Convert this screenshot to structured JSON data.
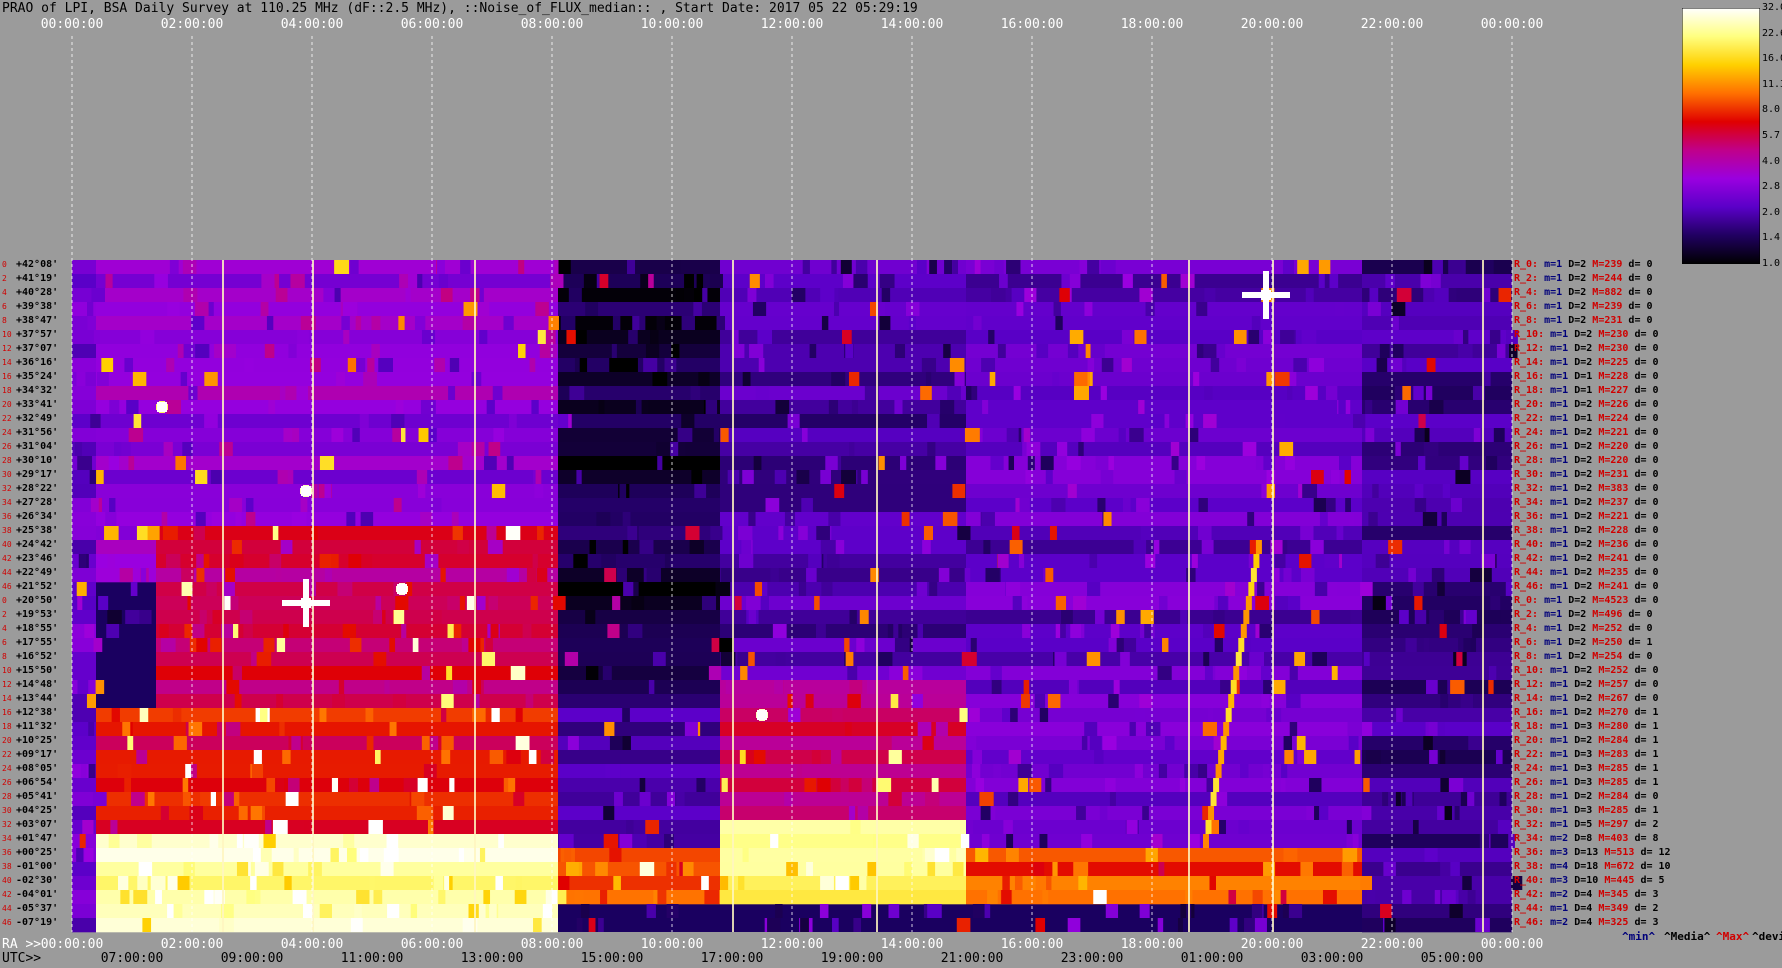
{
  "title": "PRAO of LPI, BSA Daily Survey at 110.25 MHz (dF::2.5 MHz), ::Noise_of_FLUX_median:: , Start Date: 2017 05 22 05:29:19",
  "axis": {
    "top_ticks": [
      "00:00:00",
      "02:00:00",
      "04:00:00",
      "06:00:00",
      "08:00:00",
      "10:00:00",
      "12:00:00",
      "14:00:00",
      "16:00:00",
      "18:00:00",
      "20:00:00",
      "22:00:00",
      "00:00:00"
    ],
    "ra_label": "RA >>",
    "ra_ticks": [
      "00:00:00",
      "02:00:00",
      "04:00:00",
      "06:00:00",
      "08:00:00",
      "10:00:00",
      "12:00:00",
      "14:00:00",
      "16:00:00",
      "18:00:00",
      "20:00:00",
      "22:00:00",
      "00:00:00"
    ],
    "utc_label": "UTC>>",
    "utc_ticks": [
      "07:00:00",
      "09:00:00",
      "11:00:00",
      "13:00:00",
      "15:00:00",
      "17:00:00",
      "19:00:00",
      "21:00:00",
      "23:00:00",
      "01:00:00",
      "03:00:00",
      "05:00:00"
    ]
  },
  "colorbar": {
    "labels": [
      "32.0",
      "22.6",
      "16.0",
      "11.3",
      "8.0",
      "5.7",
      "4.0",
      "2.8",
      "2.0",
      "1.4",
      "1.0"
    ],
    "stops": [
      "#ffffff",
      "#ffff80",
      "#ffd000",
      "#ff7000",
      "#e00000",
      "#c0008a",
      "#9a00e0",
      "#5a00c8",
      "#200060",
      "#000000"
    ]
  },
  "legend": {
    "min": "^min^",
    "median": "^Media^",
    "max": "^Max^",
    "devia": "^devia^"
  },
  "declinations": [
    "+42°08'",
    "+41°19'",
    "+40°28'",
    "+39°38'",
    "+38°47'",
    "+37°57'",
    "+37°07'",
    "+36°16'",
    "+35°24'",
    "+34°32'",
    "+33°41'",
    "+32°49'",
    "+31°56'",
    "+31°04'",
    "+30°10'",
    "+29°17'",
    "+28°22'",
    "+27°28'",
    "+26°34'",
    "+25°38'",
    "+24°42'",
    "+23°46'",
    "+22°49'",
    "+21°52'",
    "+20°50'",
    "+19°53'",
    "+18°55'",
    "+17°55'",
    "+16°52'",
    "+15°50'",
    "+14°48'",
    "+13°44'",
    "+12°38'",
    "+11°32'",
    "+10°25'",
    "+09°17'",
    "+08°05'",
    "+06°54'",
    "+05°41'",
    "+04°25'",
    "+03°07'",
    "+01°47'",
    "+00°25'",
    "-01°00'",
    "-02°30'",
    "-04°01'",
    "-05°37'",
    "-07°19'"
  ],
  "row_index": [
    "0",
    "2",
    "4",
    "6",
    "8",
    "10",
    "12",
    "14",
    "16",
    "18",
    "20",
    "22",
    "24",
    "26",
    "28",
    "30",
    "32",
    "34",
    "36",
    "38",
    "40",
    "42",
    "44",
    "46",
    "0",
    "2",
    "4",
    "6",
    "8",
    "10",
    "12",
    "14",
    "16",
    "18",
    "20",
    "22",
    "24",
    "26",
    "28",
    "30",
    "32",
    "34",
    "36",
    "38",
    "40",
    "42",
    "44",
    "46"
  ],
  "stats": [
    [
      "R_0:",
      "m=1",
      "D=2",
      "M=239",
      "d= 0"
    ],
    [
      "R_2:",
      "m=1",
      "D=2",
      "M=244",
      "d= 0"
    ],
    [
      "R_4:",
      "m=1",
      "D=2",
      "M=882",
      "d= 0"
    ],
    [
      "R_6:",
      "m=1",
      "D=2",
      "M=239",
      "d= 0"
    ],
    [
      "R_8:",
      "m=1",
      "D=2",
      "M=231",
      "d= 0"
    ],
    [
      "R_10:",
      "m=1",
      "D=2",
      "M=230",
      "d= 0"
    ],
    [
      "R_12:",
      "m=1",
      "D=2",
      "M=230",
      "d= 0"
    ],
    [
      "R_14:",
      "m=1",
      "D=2",
      "M=225",
      "d= 0"
    ],
    [
      "R_16:",
      "m=1",
      "D=1",
      "M=228",
      "d= 0"
    ],
    [
      "R_18:",
      "m=1",
      "D=1",
      "M=227",
      "d= 0"
    ],
    [
      "R_20:",
      "m=1",
      "D=2",
      "M=226",
      "d= 0"
    ],
    [
      "R_22:",
      "m=1",
      "D=1",
      "M=224",
      "d= 0"
    ],
    [
      "R_24:",
      "m=1",
      "D=2",
      "M=221",
      "d= 0"
    ],
    [
      "R_26:",
      "m=1",
      "D=2",
      "M=220",
      "d= 0"
    ],
    [
      "R_28:",
      "m=1",
      "D=2",
      "M=220",
      "d= 0"
    ],
    [
      "R_30:",
      "m=1",
      "D=2",
      "M=231",
      "d= 0"
    ],
    [
      "R_32:",
      "m=1",
      "D=2",
      "M=383",
      "d= 0"
    ],
    [
      "R_34:",
      "m=1",
      "D=2",
      "M=237",
      "d= 0"
    ],
    [
      "R_36:",
      "m=1",
      "D=2",
      "M=221",
      "d= 0"
    ],
    [
      "R_38:",
      "m=1",
      "D=2",
      "M=228",
      "d= 0"
    ],
    [
      "R_40:",
      "m=1",
      "D=2",
      "M=236",
      "d= 0"
    ],
    [
      "R_42:",
      "m=1",
      "D=2",
      "M=241",
      "d= 0"
    ],
    [
      "R_44:",
      "m=1",
      "D=2",
      "M=235",
      "d= 0"
    ],
    [
      "R_46:",
      "m=1",
      "D=2",
      "M=241",
      "d= 0"
    ],
    [
      "R_0:",
      "m=1",
      "D=2",
      "M=4523",
      "d= 0"
    ],
    [
      "R_2:",
      "m=1",
      "D=2",
      "M=496",
      "d= 0"
    ],
    [
      "R_4:",
      "m=1",
      "D=2",
      "M=252",
      "d= 0"
    ],
    [
      "R_6:",
      "m=1",
      "D=2",
      "M=250",
      "d= 1"
    ],
    [
      "R_8:",
      "m=1",
      "D=2",
      "M=254",
      "d= 0"
    ],
    [
      "R_10:",
      "m=1",
      "D=2",
      "M=252",
      "d= 0"
    ],
    [
      "R_12:",
      "m=1",
      "D=2",
      "M=257",
      "d= 0"
    ],
    [
      "R_14:",
      "m=1",
      "D=2",
      "M=267",
      "d= 0"
    ],
    [
      "R_16:",
      "m=1",
      "D=2",
      "M=270",
      "d= 1"
    ],
    [
      "R_18:",
      "m=1",
      "D=3",
      "M=280",
      "d= 1"
    ],
    [
      "R_20:",
      "m=1",
      "D=2",
      "M=284",
      "d= 1"
    ],
    [
      "R_22:",
      "m=1",
      "D=3",
      "M=283",
      "d= 1"
    ],
    [
      "R_24:",
      "m=1",
      "D=3",
      "M=285",
      "d= 1"
    ],
    [
      "R_26:",
      "m=1",
      "D=3",
      "M=285",
      "d= 1"
    ],
    [
      "R_28:",
      "m=1",
      "D=2",
      "M=284",
      "d= 0"
    ],
    [
      "R_30:",
      "m=1",
      "D=3",
      "M=285",
      "d= 1"
    ],
    [
      "R_32:",
      "m=1",
      "D=5",
      "M=297",
      "d= 2"
    ],
    [
      "R_34:",
      "m=2",
      "D=8",
      "M=403",
      "d= 8"
    ],
    [
      "R_36:",
      "m=3",
      "D=13",
      "M=513",
      "d= 12"
    ],
    [
      "R_38:",
      "m=4",
      "D=18",
      "M=672",
      "d= 10"
    ],
    [
      "R_40:",
      "m=3",
      "D=10",
      "M=445",
      "d= 5"
    ],
    [
      "R_42:",
      "m=2",
      "D=4",
      "M=345",
      "d= 3"
    ],
    [
      "R_44:",
      "m=1",
      "D=4",
      "M=349",
      "d= 2"
    ],
    [
      "R_46:",
      "m=2",
      "D=4",
      "M=325",
      "d= 3"
    ]
  ],
  "chart_data": {
    "type": "heatmap",
    "title": "PRAO of LPI, BSA Daily Survey at 110.25 MHz (dF::2.5 MHz), ::Noise_of_FLUX_median:: , Start Date: 2017 05 22 05:29:19",
    "x_axis": "RA 00:00:00 to 24:00:00 (UTC start 05:29:19)",
    "x_range_hours": [
      0,
      24
    ],
    "y_categories": "declinations",
    "value_range": [
      1.0,
      32.0
    ],
    "scale": "log",
    "grid": true,
    "regions": [
      {
        "ra_h": [
          0,
          0.4
        ],
        "rows": [
          0,
          47
        ],
        "level": 2.4
      },
      {
        "ra_h": [
          0.4,
          8.1
        ],
        "rows": [
          0,
          22
        ],
        "level": 3.2
      },
      {
        "ra_h": [
          1.4,
          8.1
        ],
        "rows": [
          19,
          31
        ],
        "level": 5.5
      },
      {
        "ra_h": [
          0.4,
          8.1
        ],
        "rows": [
          32,
          40
        ],
        "level": 7.0
      },
      {
        "ra_h": [
          0.4,
          8.1
        ],
        "rows": [
          41,
          47
        ],
        "level": 24.0
      },
      {
        "ra_h": [
          8.1,
          10.8
        ],
        "rows": [
          0,
          31
        ],
        "level": 1.3
      },
      {
        "ra_h": [
          8.1,
          10.8
        ],
        "rows": [
          32,
          41
        ],
        "level": 2.0
      },
      {
        "ra_h": [
          8.1,
          10.8
        ],
        "rows": [
          42,
          45
        ],
        "level": 10.0
      },
      {
        "ra_h": [
          10.8,
          14.9
        ],
        "rows": [
          0,
          29
        ],
        "level": 2.0
      },
      {
        "ra_h": [
          10.8,
          14.9
        ],
        "rows": [
          30,
          39
        ],
        "level": 5.0
      },
      {
        "ra_h": [
          10.8,
          14.9
        ],
        "rows": [
          40,
          45
        ],
        "level": 22.0
      },
      {
        "ra_h": [
          14.9,
          21.5
        ],
        "rows": [
          0,
          41
        ],
        "level": 2.3
      },
      {
        "ra_h": [
          14.9,
          21.5
        ],
        "rows": [
          42,
          45
        ],
        "level": 9.0
      },
      {
        "ra_h": [
          21.5,
          24
        ],
        "rows": [
          0,
          47
        ],
        "level": 1.8
      }
    ],
    "sources": [
      {
        "ra": 19.9,
        "row": 2,
        "level": 32,
        "size": "large"
      },
      {
        "ra": 3.9,
        "row": 24,
        "level": 32,
        "size": "large"
      },
      {
        "ra": 5.5,
        "row": 23,
        "level": 28,
        "size": "small"
      },
      {
        "ra": 3.9,
        "row": 16,
        "level": 26,
        "size": "small"
      },
      {
        "ra": 11.5,
        "row": 32,
        "level": 26,
        "size": "small"
      },
      {
        "ra": 1.5,
        "row": 10,
        "level": 20,
        "size": "small"
      }
    ],
    "bright_columns_ra": [
      2.5,
      4.0,
      6.7,
      11.0,
      13.4,
      18.6,
      20.0,
      23.5
    ],
    "dashed_columns_ra": [
      0,
      2,
      4,
      6,
      8,
      10,
      12,
      14,
      16,
      18,
      20,
      22,
      24
    ]
  }
}
